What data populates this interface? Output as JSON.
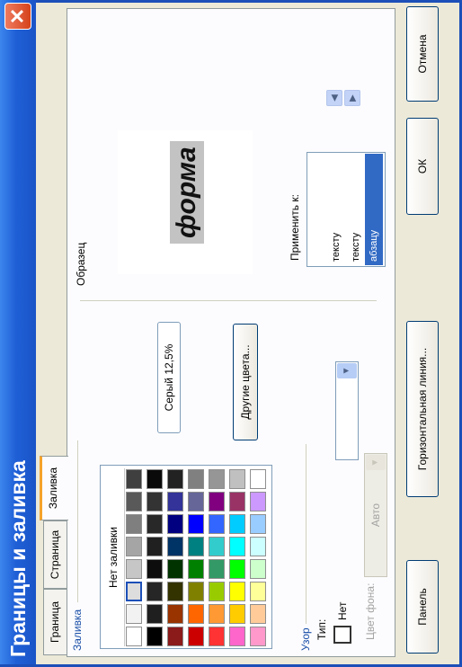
{
  "window": {
    "title": "Границы и заливка",
    "close_glyph": "✕"
  },
  "tabs": [
    {
      "label": "Граница",
      "active": false
    },
    {
      "label": "Страница",
      "active": false
    },
    {
      "label": "Заливка",
      "active": true
    }
  ],
  "fill": {
    "group_label": "Заливка",
    "no_fill_label": "Нет заливки",
    "selected_color_name": "Серый 12,5%",
    "more_colors_button": "Другие цвета...",
    "palette_rows": [
      [
        "#ffffff",
        "#f2f2f2",
        "#dddddd",
        "#c6c6c6",
        "#a5a5a5",
        "#7f7f7f",
        "#595959",
        "#3f3f3f"
      ],
      [
        "#000000",
        "#1f1f1f",
        "#262626",
        "#0d0d0d",
        "#202020",
        "#282828",
        "#333333",
        "#0a0a0a"
      ],
      [
        "#8b1a1a",
        "#993300",
        "#333300",
        "#003300",
        "#003366",
        "#000080",
        "#333399",
        "#222222"
      ],
      [
        "#cc0000",
        "#ff6600",
        "#808000",
        "#008000",
        "#008080",
        "#0000ff",
        "#666699",
        "#808080"
      ],
      [
        "#ff3333",
        "#ff9933",
        "#99cc00",
        "#339966",
        "#33cccc",
        "#3366ff",
        "#800080",
        "#969696"
      ],
      [
        "#ff66cc",
        "#ffcc00",
        "#ffff00",
        "#00ff00",
        "#00ffff",
        "#00ccff",
        "#993366",
        "#c0c0c0"
      ],
      [
        "#ff99cc",
        "#ffcc99",
        "#ffff99",
        "#ccffcc",
        "#ccffff",
        "#99ccff",
        "#cc99ff",
        "#ffffff"
      ]
    ]
  },
  "pattern": {
    "group_label": "Узор",
    "type_label": "Тип:",
    "type_value": "Нет",
    "background_color_label": "Цвет фона:",
    "background_color_value": "Авто"
  },
  "preview": {
    "group_label": "Образец",
    "sample_text": "форма"
  },
  "apply_to": {
    "label": "Применить к:",
    "items": [
      "тексту",
      "тексту",
      "абзацу"
    ],
    "selected_index": 2
  },
  "buttons": {
    "toolbar": "Панель",
    "horizontal_line": "Горизонтальная линия...",
    "ok": "ОК",
    "cancel": "Отмена"
  },
  "colors": {
    "title_bar": "#1f5fd6",
    "accent_tab": "#f5a32a",
    "selection": "#316ac5"
  }
}
